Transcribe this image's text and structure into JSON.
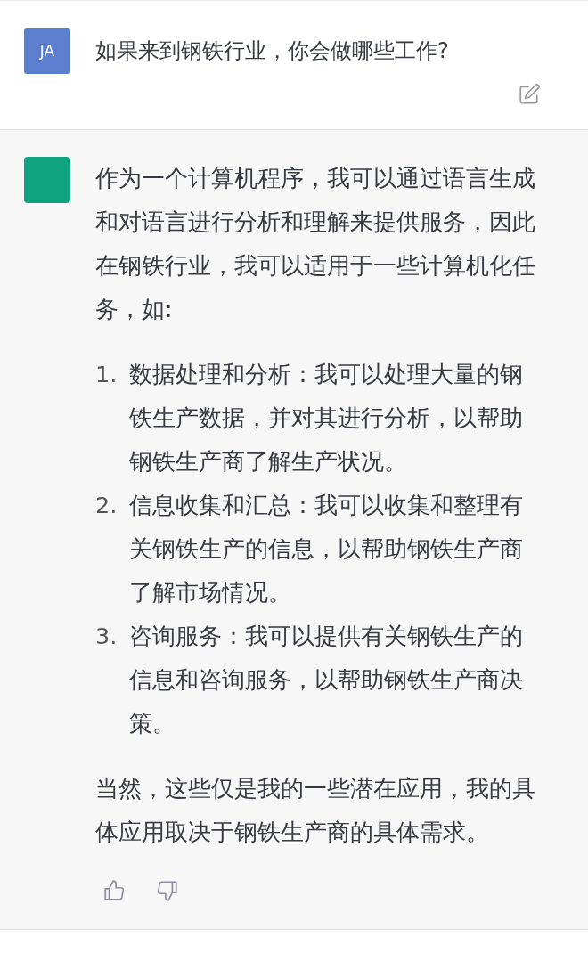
{
  "user_message": {
    "avatar": "JA",
    "text": "如果来到钢铁行业，你会做哪些工作?"
  },
  "assistant_message": {
    "intro": "作为一个计算机程序，我可以通过语言生成和对语言进行分析和理解来提供服务，因此在钢铁行业，我可以适用于一些计算机化任务，如:",
    "items": [
      {
        "number": "1.",
        "text": "数据处理和分析：我可以处理大量的钢铁生产数据，并对其进行分析，以帮助钢铁生产商了解生产状况。"
      },
      {
        "number": "2.",
        "text": "信息收集和汇总：我可以收集和整理有关钢铁生产的信息，以帮助钢铁生产商了解市场情况。"
      },
      {
        "number": "3.",
        "text": "咨询服务：我可以提供有关钢铁生产的信息和咨询服务，以帮助钢铁生产商决策。"
      }
    ],
    "closing": "当然，这些仅是我的一些潜在应用，我的具体应用取决于钢铁生产商的具体需求。"
  }
}
